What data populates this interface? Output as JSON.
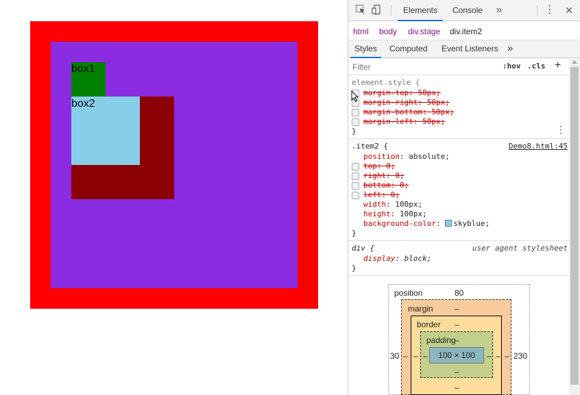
{
  "viewport": {
    "colors": {
      "stage_outer": "#ff0000",
      "stage_inner": "#8a2be2",
      "item_back": "#8b0000",
      "box1": "#008000",
      "box2": "#87ceeb"
    },
    "box1_label": "box1",
    "box2_label": "box2"
  },
  "devtools": {
    "toolbar": {
      "inspect_icon": "inspect-cursor-icon",
      "device_icon": "device-toggle-icon",
      "tabs": [
        {
          "label": "Elements"
        },
        {
          "label": "Console"
        }
      ],
      "more_tabs": "»",
      "menu": "⋮",
      "close": "✕"
    },
    "breadcrumb": {
      "html": "html",
      "body": "body",
      "stage_tag": "div",
      "stage_class": ".stage",
      "item_tag": "div",
      "item_class": ".item2"
    },
    "subtabs": [
      {
        "label": "Styles"
      },
      {
        "label": "Computed"
      },
      {
        "label": "Event Listeners"
      }
    ],
    "subtabs_more": "»",
    "filter": {
      "placeholder": "Filter",
      "hov": ":hov",
      "cls": ".cls",
      "add": "+"
    },
    "element_style": {
      "selector": "element.style {",
      "props": [
        {
          "name": "margin-top",
          "value": "50px;"
        },
        {
          "name": "margin-right",
          "value": "50px;"
        },
        {
          "name": "margin-bottom",
          "value": "50px;"
        },
        {
          "name": "margin-left",
          "value": "50px;"
        }
      ],
      "close": "}"
    },
    "item2_rule": {
      "selector": ".item2 {",
      "source": "Demo8.html:45",
      "position_name": "position",
      "position_value": "absolute;",
      "struck": [
        {
          "name": "top",
          "value": "0;"
        },
        {
          "name": "right",
          "value": "0;"
        },
        {
          "name": "bottom",
          "value": "0;"
        },
        {
          "name": "left",
          "value": "0;"
        }
      ],
      "width_name": "width",
      "width_value": "100px;",
      "height_name": "height",
      "height_value": "100px;",
      "bg_name": "background-color",
      "bg_value": "skyblue;",
      "bg_swatch": "#87ceeb",
      "close": "}"
    },
    "div_rule": {
      "selector": "div {",
      "source": "user agent stylesheet",
      "display_name": "display",
      "display_value": "block;",
      "close": "}"
    },
    "box_model": {
      "position_label": "position",
      "position_top": "80",
      "position_left": "30",
      "position_right": "230",
      "margin_label": "margin",
      "margin_top": "–",
      "margin_left": "–",
      "margin_right": "–",
      "border_label": "border",
      "border_top": "–",
      "border_left": "–",
      "border_right": "–",
      "border_bottom": "–",
      "padding_label": "padding",
      "padding_top": "–",
      "padding_left": "–",
      "padding_right": "–",
      "padding_bottom": "–",
      "content_size": "100 × 100"
    }
  }
}
